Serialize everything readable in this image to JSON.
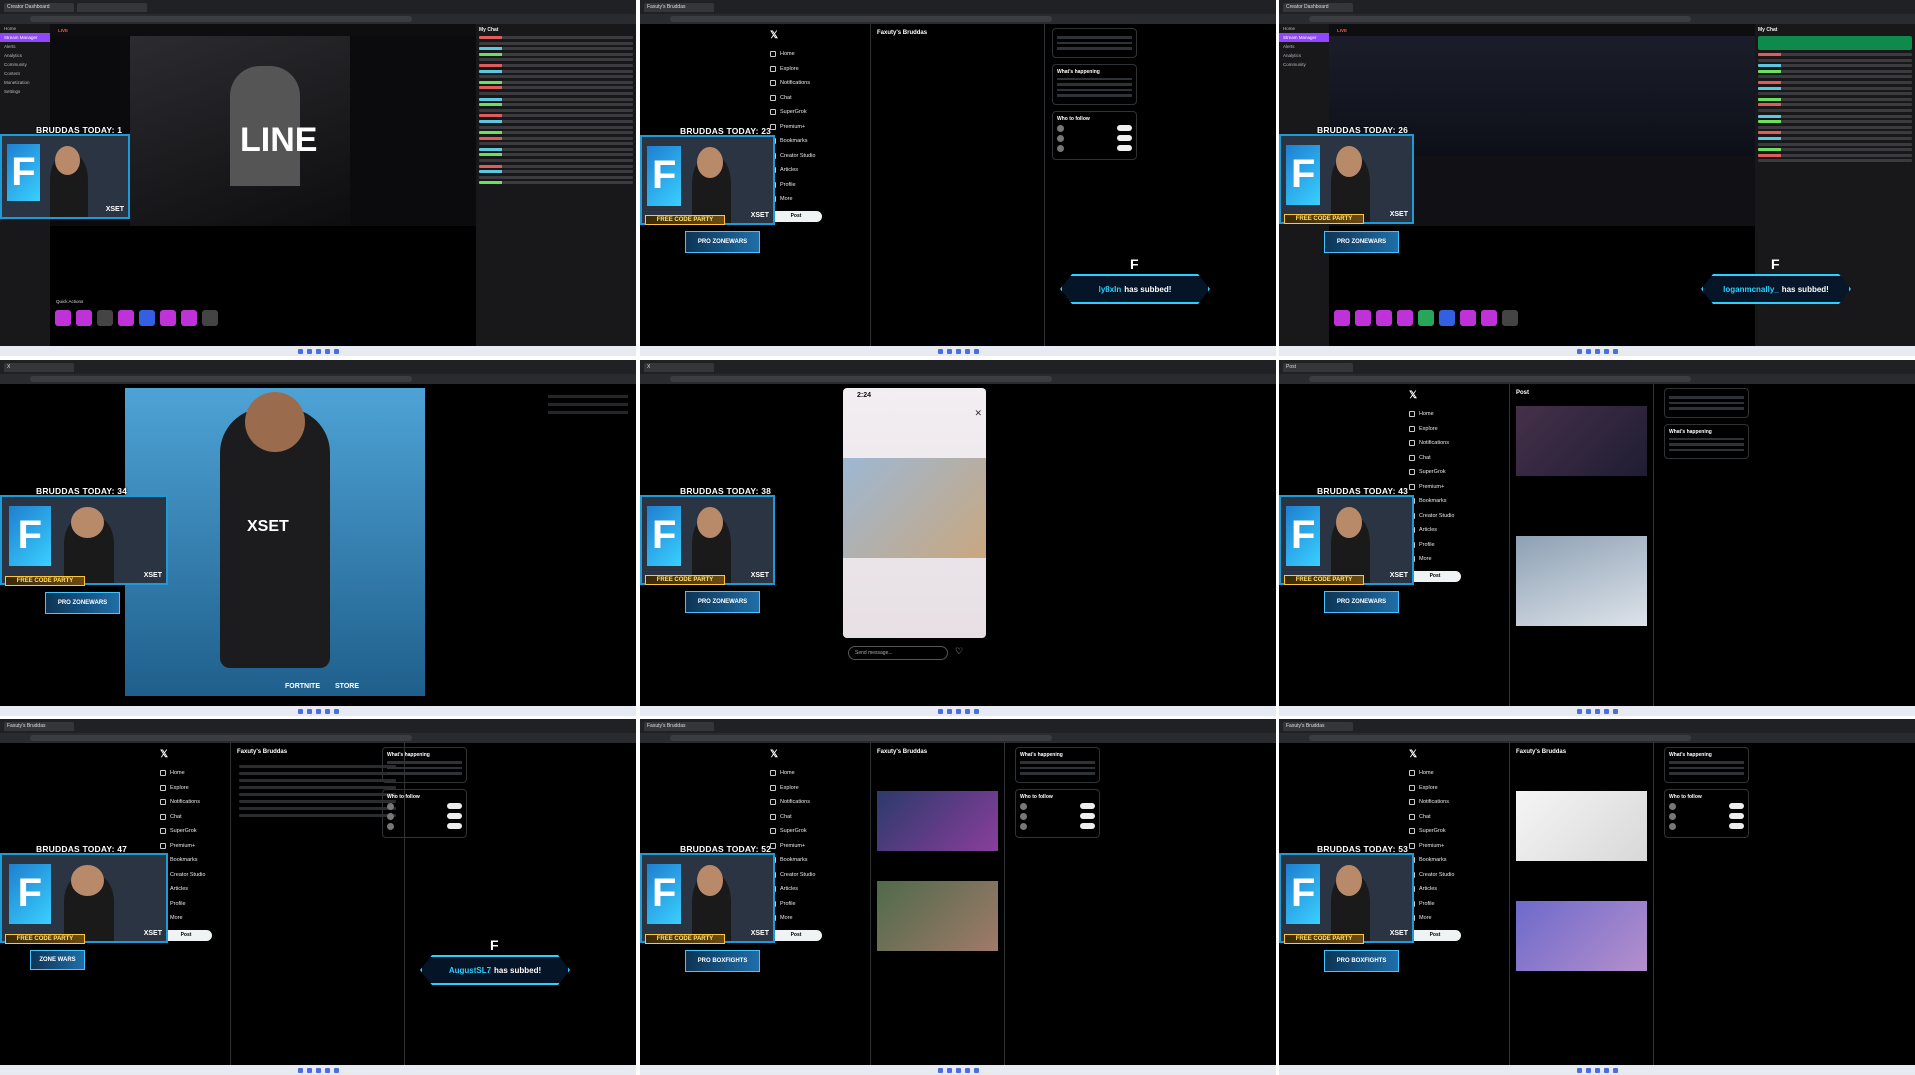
{
  "cells": [
    {
      "counter": "BRUDDAS TODAY: 1",
      "type": "twitch",
      "tab": "Creator Dashboard",
      "sub_name": "",
      "sub_text": ""
    },
    {
      "counter": "BRUDDAS TODAY: 23",
      "type": "x",
      "tab": "Faxuty's Bruddas",
      "sub_name": "ly8xIn",
      "sub_text": "has subbed!"
    },
    {
      "counter": "BRUDDAS TODAY: 26",
      "type": "twitch",
      "tab": "Creator Dashboard",
      "sub_name": "loganmcnally_",
      "sub_text": "has subbed!"
    },
    {
      "counter": "BRUDDAS TODAY: 34",
      "type": "image",
      "tab": "X",
      "sub_name": "",
      "sub_text": ""
    },
    {
      "counter": "BRUDDAS TODAY: 38",
      "type": "story",
      "tab": "X",
      "sub_name": "",
      "sub_text": ""
    },
    {
      "counter": "BRUDDAS TODAY: 43",
      "type": "x",
      "tab": "Post",
      "sub_name": "",
      "sub_text": ""
    },
    {
      "counter": "BRUDDAS TODAY: 47",
      "type": "x",
      "tab": "Faxuty's Bruddas",
      "sub_name": "AugustSL7",
      "sub_text": "has subbed!"
    },
    {
      "counter": "BRUDDAS TODAY: 52",
      "type": "x",
      "tab": "Faxuty's Bruddas",
      "sub_name": "",
      "sub_text": ""
    },
    {
      "counter": "BRUDDAS TODAY: 53",
      "type": "x",
      "tab": "Faxuty's Bruddas",
      "sub_name": "",
      "sub_text": ""
    }
  ],
  "banners": {
    "free_code": "FREE CODE PARTY",
    "zone_wars": "ZONE WARS",
    "pro_zonewars": "PRO ZONEWARS",
    "pro_boxfights": "PRO BOXFIGHTS"
  },
  "xnav": [
    "Home",
    "Explore",
    "Notifications",
    "Chat",
    "SuperGrok",
    "Premium+",
    "Bookmarks",
    "Creator Studio",
    "Articles",
    "Profile",
    "More"
  ],
  "xnav_post": "Post",
  "x_side": {
    "happening": "What's happening",
    "follow": "Who to follow"
  },
  "twitch": {
    "live": "LIVE",
    "chat": "My Chat",
    "quick_actions": "Quick Actions",
    "nav": [
      "Home",
      "Stream Manager",
      "Alerts",
      "Analytics",
      "Community",
      "Content",
      "Monetization",
      "Settings"
    ]
  },
  "story": {
    "time": "2:24",
    "message_placeholder": "Send message..."
  },
  "brand": {
    "fortnite": "FORTNITE",
    "xset": "XSET",
    "store": "STORE",
    "line": "LINE"
  },
  "colors": {
    "accent": "#1d9bd6",
    "twitch": "#9147ff",
    "sub_border": "#2ad1ff"
  }
}
